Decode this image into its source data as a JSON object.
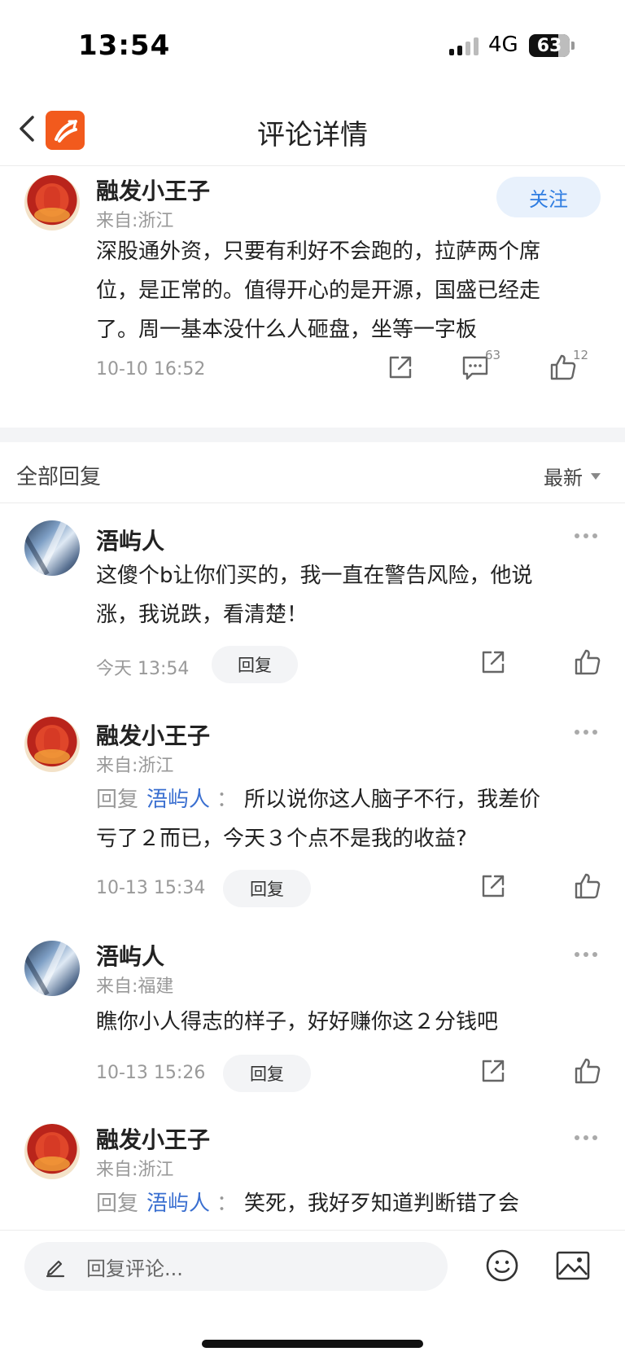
{
  "status_bar": {
    "time": "13:54",
    "network": "4G",
    "battery": "63"
  },
  "nav": {
    "title": "评论详情"
  },
  "main_comment": {
    "username": "融发小王子",
    "location": "来自:浙江",
    "follow_label": "关注",
    "lines": [
      "深股通外资，只要有利好不会跑的，拉萨两个席",
      "位，是正常的。值得开心的是开源，国盛已经走",
      "了。周一基本没什么人砸盘，坐等一字板"
    ],
    "time": "10-10 16:52",
    "comment_count": "63",
    "like_count": "12"
  },
  "replies_header": {
    "title": "全部回复",
    "sort": "最新"
  },
  "replies": [
    {
      "username": "浯屿人",
      "lines": [
        "这傻个b让你们买的，我一直在警告风险，他说",
        "涨，我说跌，看清楚！"
      ],
      "time": "今天 13:54",
      "reply_label": "回复"
    },
    {
      "username": "融发小王子",
      "location": "来自:浙江",
      "reply_prefix": "回复",
      "reply_target": "浯屿人",
      "reply_colon": "：",
      "line1": "所以说你这人脑子不行，我差价",
      "line2": "亏了２而已，今天３个点不是我的收益?",
      "time": "10-13 15:34",
      "reply_label": "回复"
    },
    {
      "username": "浯屿人",
      "location": "来自:福建",
      "lines": [
        "瞧你小人得志的样子，好好赚你这２分钱吧"
      ],
      "time": "10-13 15:26",
      "reply_label": "回复"
    },
    {
      "username": "融发小王子",
      "location": "来自:浙江",
      "reply_prefix": "回复",
      "reply_target": "浯屿人",
      "reply_colon": "：",
      "line1": "笑死，我好歹知道判断错了会"
    }
  ],
  "bottom_bar": {
    "placeholder": "回复评论..."
  }
}
